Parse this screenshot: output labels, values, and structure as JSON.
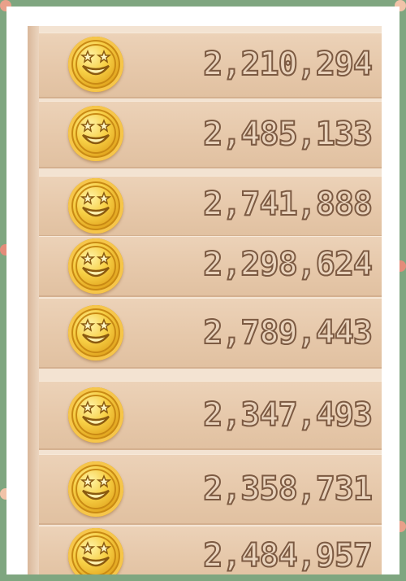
{
  "rows": [
    {
      "amount": "2,210,294",
      "icon": "gold-coin-icon"
    },
    {
      "amount": "2,485,133",
      "icon": "gold-coin-icon"
    },
    {
      "amount": "2,741,888",
      "icon": "gold-coin-icon"
    },
    {
      "amount": "2,298,624",
      "icon": "gold-coin-icon"
    },
    {
      "amount": "2,789,443",
      "icon": "gold-coin-icon"
    },
    {
      "amount": "2,347,493",
      "icon": "gold-coin-icon"
    },
    {
      "amount": "2,358,731",
      "icon": "gold-coin-icon"
    },
    {
      "amount": "2,484,957",
      "icon": "gold-coin-icon"
    }
  ],
  "colors": {
    "frame": "#7fa680",
    "panel": "#f3e3d2",
    "row": "#e6c8aa",
    "coin": "#f7cf45",
    "text_outline": "#7c5a42"
  }
}
